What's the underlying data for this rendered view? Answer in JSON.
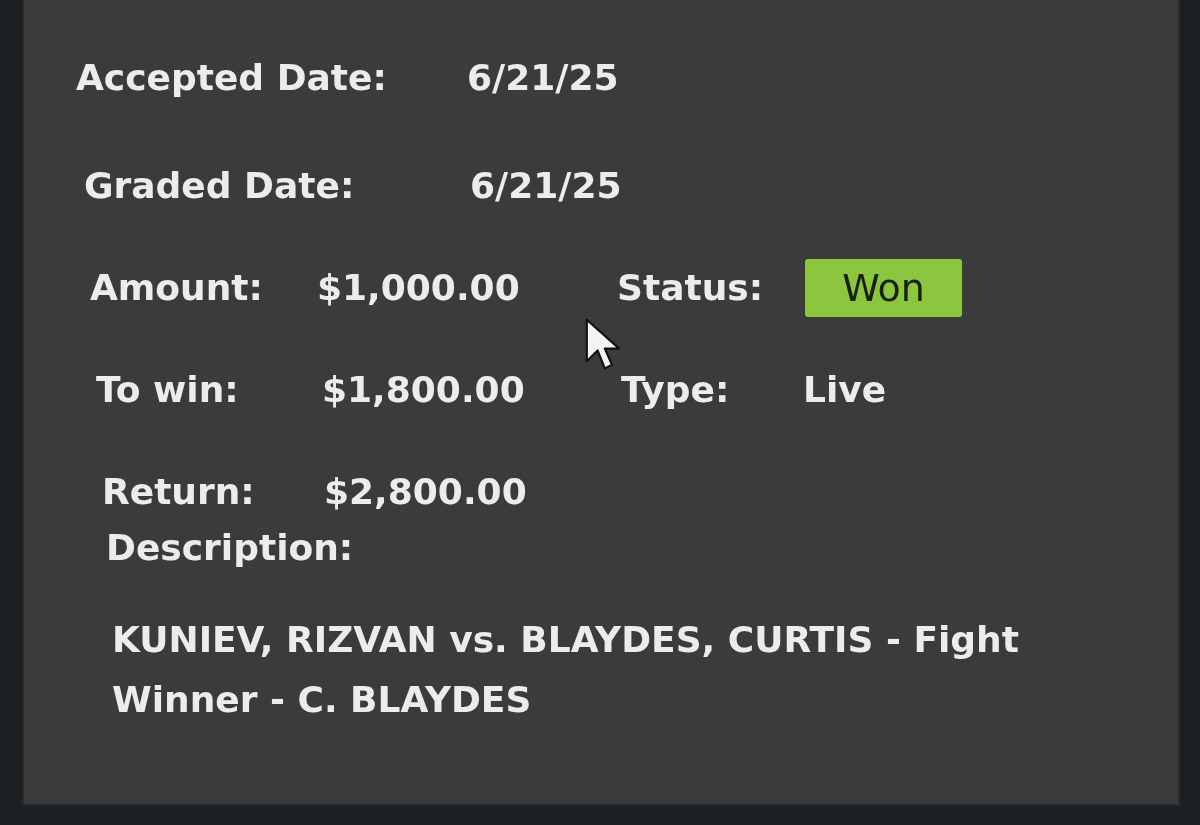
{
  "dates": [
    {
      "label": "Accepted Date:",
      "value": "6/21/25"
    },
    {
      "label": "Graded Date:",
      "value": "6/21/25"
    }
  ],
  "amounts": [
    {
      "label": "Amount:",
      "value": "$1,000.00",
      "side": {
        "label": "Status:",
        "value": "Won",
        "kind": "badge"
      }
    },
    {
      "label": "To win:",
      "value": "$1,800.00",
      "side": {
        "label": "Type:",
        "value": "Live",
        "kind": "text"
      }
    },
    {
      "label": "Return:",
      "value": "$2,800.00"
    }
  ],
  "description": {
    "label": "Description:",
    "text": "KUNIEV, RIZVAN vs. BLAYDES, CURTIS - Fight Winner - C. BLAYDES"
  }
}
